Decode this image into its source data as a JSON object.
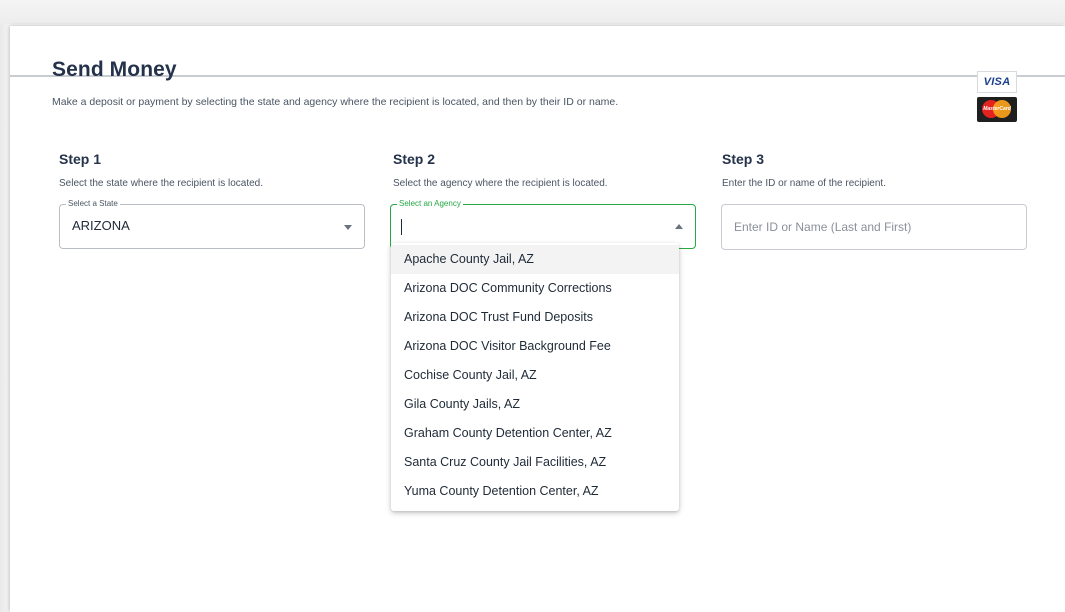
{
  "page": {
    "title": "Send Money",
    "subtitle": "Make a deposit or payment by selecting the state and agency where the recipient is located, and then by their ID or name."
  },
  "payment_logos": {
    "visa": "VISA",
    "mastercard": "MasterCard"
  },
  "steps": [
    {
      "title": "Step 1",
      "description": "Select the state where the recipient is located.",
      "field_label": "Select a State",
      "value": "ARIZONA",
      "icon": "chevron-down-icon"
    },
    {
      "title": "Step 2",
      "description": "Select the agency where the recipient is located.",
      "field_label": "Select an Agency",
      "value": "",
      "icon": "chevron-up-icon",
      "focus_color": "#27a844"
    },
    {
      "title": "Step 3",
      "description": "Enter the ID or name of the recipient.",
      "placeholder": "Enter ID or Name (Last and First)"
    }
  ],
  "agency_options": [
    "Apache County Jail, AZ",
    "Arizona DOC Community Corrections",
    "Arizona DOC Trust Fund Deposits",
    "Arizona DOC Visitor Background Fee",
    "Cochise County Jail, AZ",
    "Gila County Jails, AZ",
    "Graham County Detention Center, AZ",
    "Santa Cruz County Jail Facilities, AZ",
    "Yuma County Detention Center, AZ"
  ],
  "highlighted_option": "Apache County Jail, AZ"
}
